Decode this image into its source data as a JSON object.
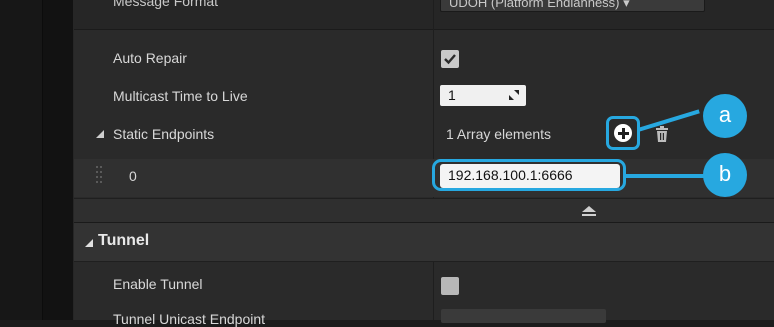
{
  "header": {
    "message_format_label": "Message Format",
    "message_format_value": "UDOH (Platform Endianness) ▾"
  },
  "rows": {
    "auto_repair": {
      "label": "Auto Repair",
      "checked": true
    },
    "multicast_ttl": {
      "label": "Multicast Time to Live",
      "value": "1"
    },
    "static_endpoints": {
      "label": "Static Endpoints",
      "summary": "1 Array elements"
    },
    "endpoint_0": {
      "index": "0",
      "value": "192.168.100.1:6666"
    }
  },
  "tunnel": {
    "section_label": "Tunnel",
    "enable_tunnel_label": "Enable Tunnel",
    "enable_tunnel_checked": false,
    "unicast_endpoint_label": "Tunnel Unicast Endpoint"
  },
  "callouts": {
    "a": "a",
    "b": "b"
  },
  "colors": {
    "accent": "#27a8e0",
    "panel": "#2a2a2a"
  }
}
